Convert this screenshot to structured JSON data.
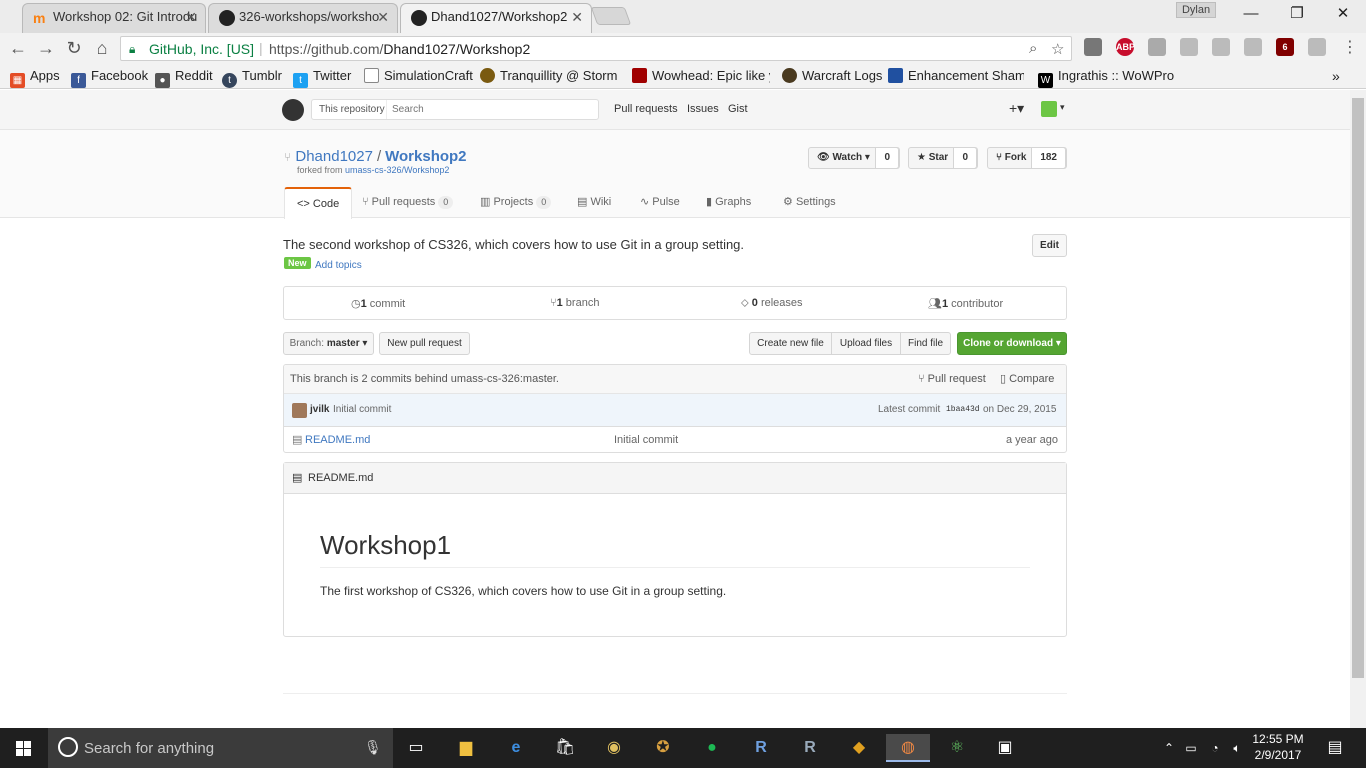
{
  "browser": {
    "tabs": [
      {
        "title": "Workshop 02: Git Introdu",
        "close": "✕"
      },
      {
        "title": "326-workshops/worksho",
        "close": "✕"
      },
      {
        "title": "Dhand1027/Workshop2",
        "close": "✕"
      }
    ],
    "profile": "Dylan",
    "window_controls": {
      "minimize": "—",
      "restore": "❐",
      "close": "✕"
    },
    "secure_label": "GitHub, Inc. [US]",
    "url_prefix": "https://github.com/",
    "url_path": "Dhand1027/Workshop2",
    "extensions": [
      {
        "label": "ABP",
        "color": "#c70d2c"
      },
      {
        "label": "6",
        "color": "#800000"
      }
    ],
    "bookmarks": [
      {
        "label": "Apps",
        "color": "#e44d26"
      },
      {
        "label": "Facebook",
        "color": "#3b5998"
      },
      {
        "label": "Reddit",
        "color": "#555555"
      },
      {
        "label": "Tumblr",
        "color": "#36465d"
      },
      {
        "label": "Twitter",
        "color": "#1da1f2"
      },
      {
        "label": "SimulationCraft",
        "color": "#888888"
      },
      {
        "label": "Tranquillity @ Stormr",
        "color": "#7a5a10"
      },
      {
        "label": "Wowhead: Epic like yo",
        "color": "#a00000"
      },
      {
        "label": "Warcraft Logs",
        "color": "#4a3a20"
      },
      {
        "label": "Enhancement Shamar",
        "color": "#2050a0"
      },
      {
        "label": "Ingrathis :: WoWProgr",
        "color": "#000000"
      }
    ],
    "more_bookmarks": "»"
  },
  "github": {
    "search_scope": "This repository",
    "search_placeholder": "Search",
    "nav": [
      "Pull requests",
      "Issues",
      "Gist"
    ],
    "plus": "+▾",
    "owner": "Dhand1027",
    "repo": "Workshop2",
    "forked_prefix": "forked from",
    "forked_from": "umass-cs-326/Workshop2",
    "watch": {
      "label": "Watch ▾",
      "count": "0"
    },
    "star": {
      "label": "Star",
      "count": "0"
    },
    "fork": {
      "label": "Fork",
      "count": "182"
    },
    "tabs": [
      {
        "label": "Code",
        "count": ""
      },
      {
        "label": "Pull requests",
        "count": "0"
      },
      {
        "label": "Projects",
        "count": "0"
      },
      {
        "label": "Wiki",
        "count": ""
      },
      {
        "label": "Pulse",
        "count": ""
      },
      {
        "label": "Graphs",
        "count": ""
      },
      {
        "label": "Settings",
        "count": ""
      }
    ],
    "description": "The second workshop of CS326, which covers how to use Git in a group setting.",
    "new_badge": "New",
    "add_topics": "Add topics",
    "edit": "Edit",
    "numbers": [
      {
        "value": "1",
        "label": "commit"
      },
      {
        "value": "1",
        "label": "branch"
      },
      {
        "value": "0",
        "label": "releases"
      },
      {
        "value": "1",
        "label": "contributor"
      }
    ],
    "branch_label": "Branch:",
    "branch_name": "master ▾",
    "new_pull_request": "New pull request",
    "create_new_file": "Create new file",
    "upload_files": "Upload files",
    "find_file": "Find file",
    "clone_or_download": "Clone or download ▾",
    "behind_text": "This branch is 2 commits behind umass-cs-326:master.",
    "pull_request": "Pull request",
    "compare": "Compare",
    "commit_author": "jvilk",
    "commit_message": "Initial commit",
    "latest_commit_label": "Latest commit",
    "latest_commit_sha": "1baa43d",
    "latest_commit_date": "on Dec 29, 2015",
    "files": [
      {
        "name": "README.md",
        "message": "Initial commit",
        "age": "a year ago"
      }
    ],
    "readme_title": "README.md",
    "readme_h1": "Workshop1",
    "readme_p": "The first workshop of CS326, which covers how to use Git in a group setting."
  },
  "taskbar": {
    "search": "Search for anything",
    "time": "12:55 PM",
    "date": "2/9/2017"
  }
}
